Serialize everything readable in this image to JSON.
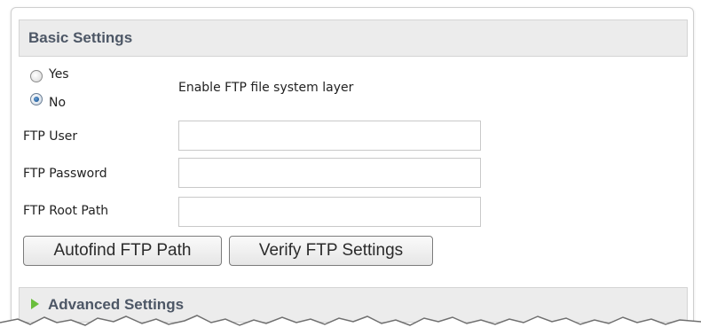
{
  "basic_settings": {
    "title": "Basic Settings",
    "enable_ftp": {
      "yes_label": "Yes",
      "no_label": "No",
      "selected": "No",
      "description": "Enable FTP file system layer"
    },
    "ftp_user": {
      "label": "FTP User",
      "value": ""
    },
    "ftp_password": {
      "label": "FTP Password",
      "value": ""
    },
    "ftp_root_path": {
      "label": "FTP Root Path",
      "value": ""
    },
    "buttons": {
      "autofind": "Autofind FTP Path",
      "verify": "Verify FTP Settings"
    }
  },
  "advanced_settings": {
    "title": "Advanced Settings",
    "expanded": false
  },
  "colors": {
    "header_bg": "#ececec",
    "header_text": "#4d5766",
    "expand_arrow": "#6abe3c",
    "radio_selected": "#225e9c"
  },
  "icons": {
    "expand": "triangle-right-icon"
  }
}
